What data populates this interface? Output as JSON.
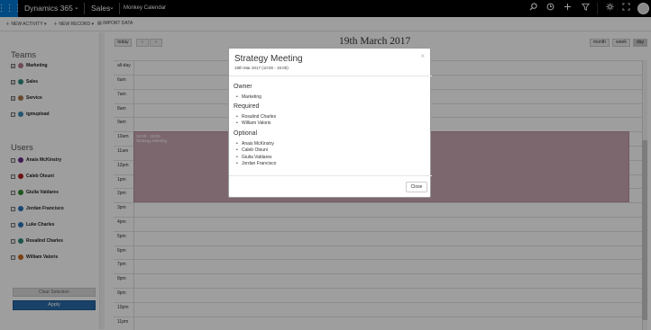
{
  "topbar": {
    "app_name": "Dynamics 365",
    "area": "Sales",
    "page": "Monkey Calendar",
    "icons": [
      "waffle-icon",
      "chevron-down-icon",
      "chevron-down-icon",
      "search-icon",
      "history-icon",
      "plus-icon",
      "filter-icon",
      "gear-icon",
      "help-icon"
    ]
  },
  "commandbar": {
    "new_activity": "NEW ACTIVITY",
    "new_record": "NEW RECORD",
    "import_data": "IMPORT DATA"
  },
  "sidebar": {
    "teams_title": "Teams",
    "teams": [
      {
        "label": "Marketing",
        "checked": true,
        "color": "#b47b89"
      },
      {
        "label": "Sales",
        "checked": true,
        "color": "#2f8a7d"
      },
      {
        "label": "Service",
        "checked": true,
        "color": "#a8774a"
      },
      {
        "label": "tgmupload",
        "checked": false,
        "color": "#3b8ab7"
      }
    ],
    "users_title": "Users",
    "users": [
      {
        "label": "Anais McKinstry",
        "checked": false,
        "color": "#6a2c8a"
      },
      {
        "label": "Caleb Otsuni",
        "checked": false,
        "color": "#b01e1e"
      },
      {
        "label": "Giulia Valdares",
        "checked": false,
        "color": "#2f8a2f"
      },
      {
        "label": "Jordan Francisco",
        "checked": false,
        "color": "#2a73b8"
      },
      {
        "label": "Luke Charles",
        "checked": false,
        "color": "#2a73b8"
      },
      {
        "label": "Rosalind Charles",
        "checked": false,
        "color": "#2f8a7d"
      },
      {
        "label": "William Valoris",
        "checked": false,
        "color": "#c86a1c"
      }
    ],
    "clear_label": "Clear Selection",
    "apply_label": "Apply"
  },
  "calendar": {
    "today": "today",
    "prev": "‹",
    "next": "›",
    "title": "19th March 2017",
    "views": [
      "month",
      "week",
      "day"
    ],
    "active_view": "day",
    "allday": "all-day",
    "times": [
      "6am",
      "7am",
      "8am",
      "9am",
      "10am",
      "11am",
      "12pm",
      "1pm",
      "2pm",
      "3pm",
      "4pm",
      "5pm",
      "6pm",
      "7pm",
      "8pm",
      "9pm",
      "10pm",
      "11pm"
    ],
    "event": {
      "time": "10:00 - 15:00",
      "title": "Strategy Meeting",
      "color": "#c8a6b3"
    }
  },
  "modal": {
    "title": "Strategy Meeting",
    "date": "19th Mar 2017 (10:00 - 15:00)",
    "owner_title": "Owner",
    "owner": [
      "Marketing"
    ],
    "required_title": "Required",
    "required": [
      "Rosalind Charles",
      "William Valoris"
    ],
    "optional_title": "Optional",
    "optional": [
      "Anais McKinstry",
      "Caleb Otsuni",
      "Giulia Valdares",
      "Jordan Francisco"
    ],
    "close_label": "Close",
    "close_x": "×"
  }
}
